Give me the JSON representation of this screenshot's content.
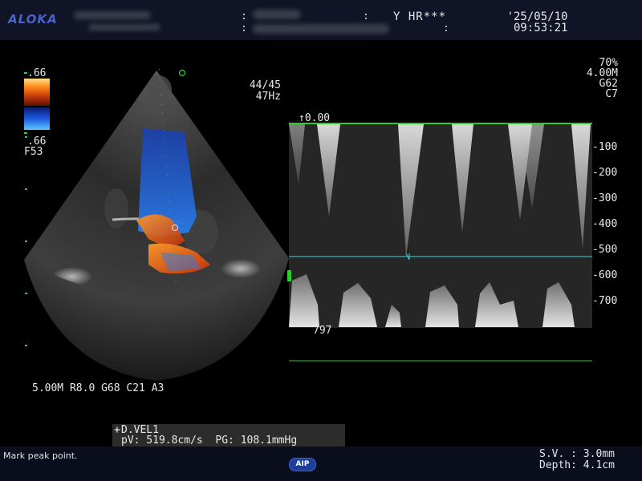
{
  "header": {
    "logo": "ALOKA",
    "hr_label": "Y HR***",
    "date": "'25/05/10",
    "time": "09:53:21",
    "colon": ":"
  },
  "color_scale": {
    "top_value": ".66",
    "bottom_value": ".66",
    "filter": "F53"
  },
  "frame_info": {
    "frame": "44/45",
    "rate": "47Hz"
  },
  "doppler_settings": {
    "power": "70%",
    "freq": "4.00M",
    "gain": "G62",
    "compression": "C7"
  },
  "spectrum": {
    "baseline_label": "↑0.00",
    "scale_ticks": [
      "-100",
      "-200",
      "-300",
      "-400",
      "-500",
      "-600",
      "-700"
    ],
    "peak_readout": "797"
  },
  "bmode_settings": "5.00M R8.0 G68 C21 A3",
  "measurement": {
    "name": "D.VEL1",
    "marker": "+",
    "result": "pV: 519.8cm/s  PG: 108.1mmHg"
  },
  "status": {
    "message": "Mark peak point.",
    "aip_button": "AIP"
  },
  "sample_volume": {
    "sv": "S.V. : 3.0mm",
    "depth": "Depth: 4.1cm"
  },
  "colors": {
    "accent_green": "#2ecc2e",
    "cursor_cyan": "#3fd1e0",
    "logo_blue": "#4a63c9",
    "aip_blue": "#1d3e9a"
  }
}
